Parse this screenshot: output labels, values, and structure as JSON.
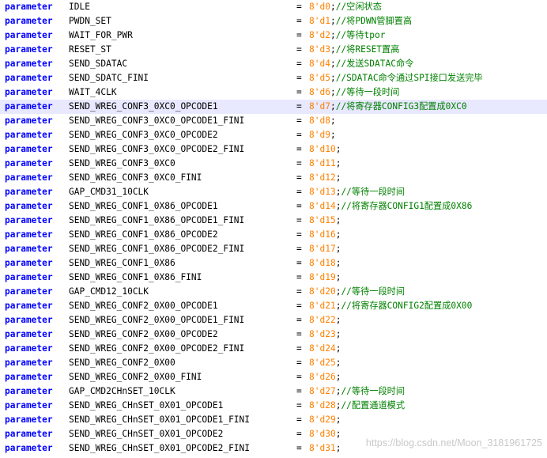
{
  "editor": {
    "keyword": "parameter",
    "equals": "=",
    "lines": [
      {
        "name": "IDLE",
        "value": "8'd0",
        "comment": "//空闲状态"
      },
      {
        "name": "PWDN_SET",
        "value": "8'd1",
        "comment": "//将PDWN管脚置高"
      },
      {
        "name": "WAIT_FOR_PWR",
        "value": "8'd2",
        "comment": "//等待tpor"
      },
      {
        "name": "RESET_ST",
        "value": "8'd3",
        "comment": "//将RESET置高"
      },
      {
        "name": "SEND_SDATAC",
        "value": "8'd4",
        "comment": "//发送SDATAC命令"
      },
      {
        "name": "SEND_SDATC_FINI",
        "value": "8'd5",
        "comment": "//SDATAC命令通过SPI接口发送完毕"
      },
      {
        "name": "WAIT_4CLK",
        "value": "8'd6",
        "comment": "//等待一段时间"
      },
      {
        "name": "SEND_WREG_CONF3_0XC0_OPCODE1",
        "value": "8'd7",
        "comment": "//将寄存器CONFIG3配置成0XC0",
        "highlight": true
      },
      {
        "name": "SEND_WREG_CONF3_0XC0_OPCODE1_FINI",
        "value": "8'd8",
        "comment": ""
      },
      {
        "name": "SEND_WREG_CONF3_0XC0_OPCODE2",
        "value": "8'd9",
        "comment": ""
      },
      {
        "name": "SEND_WREG_CONF3_0XC0_OPCODE2_FINI",
        "value": "8'd10",
        "comment": ""
      },
      {
        "name": "SEND_WREG_CONF3_0XC0",
        "value": "8'd11",
        "comment": ""
      },
      {
        "name": "SEND_WREG_CONF3_0XC0_FINI",
        "value": "8'd12",
        "comment": ""
      },
      {
        "name": "GAP_CMD31_10CLK",
        "value": "8'd13",
        "comment": "//等待一段时间"
      },
      {
        "name": "SEND_WREG_CONF1_0X86_OPCODE1",
        "value": "8'd14",
        "comment": "//将寄存器CONFIG1配置成0X86"
      },
      {
        "name": "SEND_WREG_CONF1_0X86_OPCODE1_FINI",
        "value": "8'd15",
        "comment": ""
      },
      {
        "name": "SEND_WREG_CONF1_0X86_OPCODE2",
        "value": "8'd16",
        "comment": ""
      },
      {
        "name": "SEND_WREG_CONF1_0X86_OPCODE2_FINI",
        "value": "8'd17",
        "comment": ""
      },
      {
        "name": "SEND_WREG_CONF1_0X86",
        "value": "8'd18",
        "comment": ""
      },
      {
        "name": "SEND_WREG_CONF1_0X86_FINI",
        "value": "8'd19",
        "comment": ""
      },
      {
        "name": "GAP_CMD12_10CLK",
        "value": "8'd20",
        "comment": "//等待一段时间"
      },
      {
        "name": "SEND_WREG_CONF2_0X00_OPCODE1",
        "value": "8'd21",
        "comment": "//将寄存器CONFIG2配置成0X00"
      },
      {
        "name": "SEND_WREG_CONF2_0X00_OPCODE1_FINI",
        "value": "8'd22",
        "comment": ""
      },
      {
        "name": "SEND_WREG_CONF2_0X00_OPCODE2",
        "value": "8'd23",
        "comment": ""
      },
      {
        "name": "SEND_WREG_CONF2_0X00_OPCODE2_FINI",
        "value": "8'd24",
        "comment": ""
      },
      {
        "name": "SEND_WREG_CONF2_0X00",
        "value": "8'd25",
        "comment": ""
      },
      {
        "name": "SEND_WREG_CONF2_0X00_FINI",
        "value": "8'd26",
        "comment": ""
      },
      {
        "name": "GAP_CMD2CHnSET_10CLK",
        "value": "8'd27",
        "comment": "//等待一段时间"
      },
      {
        "name": "SEND_WREG_CHnSET_0X01_OPCODE1",
        "value": "8'd28",
        "comment": "//配置通道模式"
      },
      {
        "name": "SEND_WREG_CHnSET_0X01_OPCODE1_FINI",
        "value": "8'd29",
        "comment": ""
      },
      {
        "name": "SEND_WREG_CHnSET_0X01_OPCODE2",
        "value": "8'd30",
        "comment": ""
      },
      {
        "name": "SEND_WREG_CHnSET_0X01_OPCODE2_FINI",
        "value": "8'd31",
        "comment": ""
      }
    ]
  },
  "watermark": "https://blog.csdn.net/Moon_3181961725",
  "colors": {
    "keyword": "#0000ff",
    "number": "#ff8000",
    "comment": "#008000",
    "highlight_line": "#e8e8ff"
  }
}
